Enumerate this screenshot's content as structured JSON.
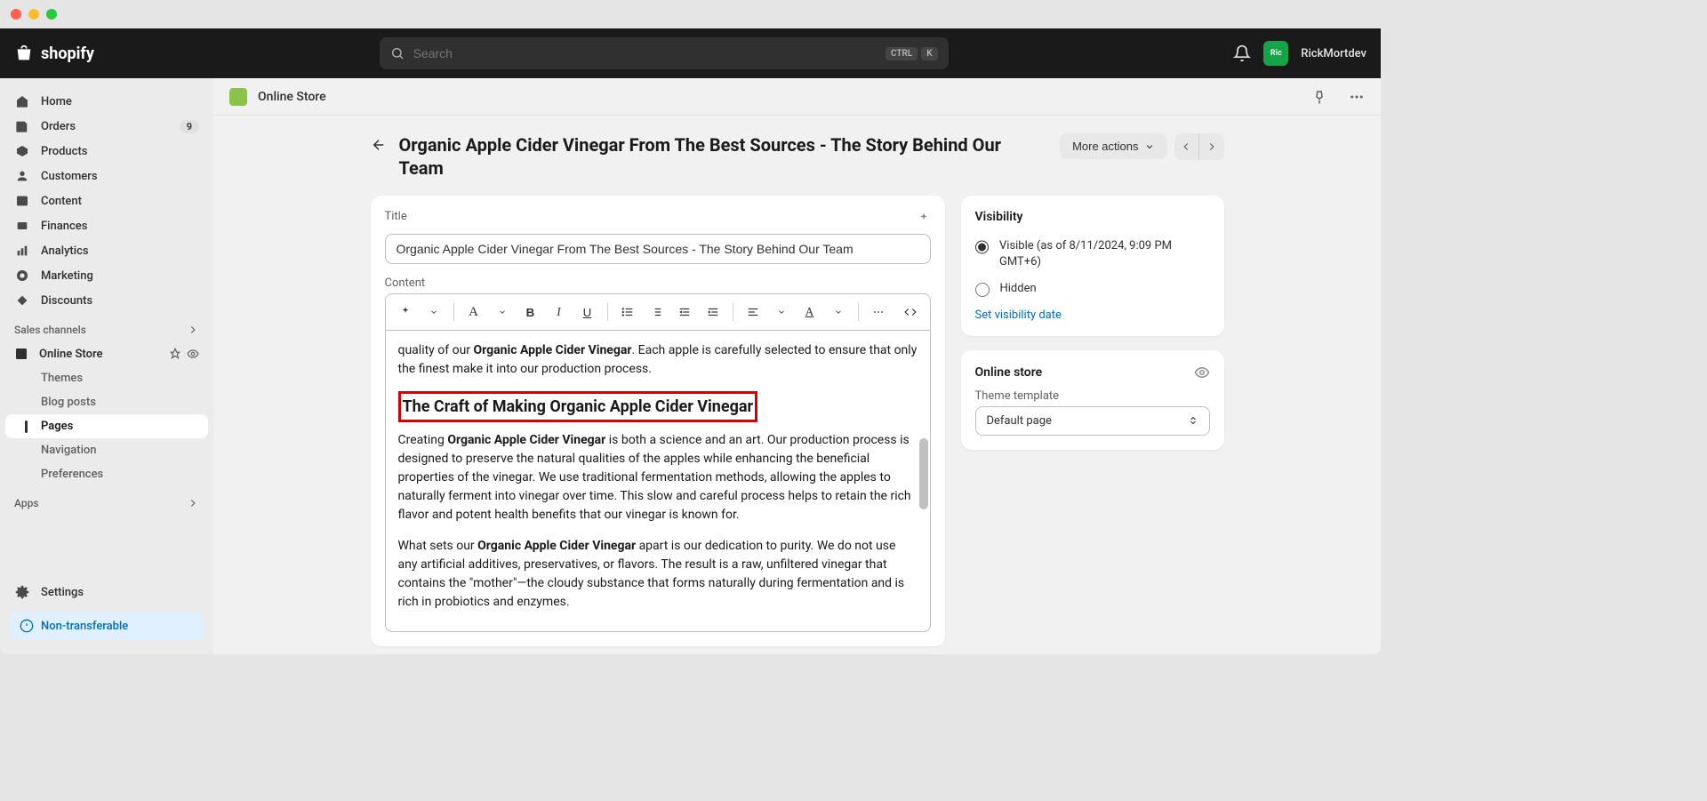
{
  "header": {
    "brand": "shopify",
    "search_placeholder": "Search",
    "kbd_ctrl": "CTRL",
    "kbd_k": "K",
    "avatar_short": "Ric",
    "username": "RickMortdev"
  },
  "sidebar": {
    "home": "Home",
    "orders": {
      "label": "Orders",
      "badge": "9"
    },
    "products": "Products",
    "customers": "Customers",
    "content": "Content",
    "finances": "Finances",
    "analytics": "Analytics",
    "marketing": "Marketing",
    "discounts": "Discounts",
    "sales_channels": "Sales channels",
    "online_store": "Online Store",
    "themes": "Themes",
    "blog_posts": "Blog posts",
    "pages": "Pages",
    "navigation": "Navigation",
    "preferences": "Preferences",
    "apps": "Apps",
    "settings": "Settings",
    "non_transferable": "Non-transferable"
  },
  "main_header": {
    "title": "Online Store"
  },
  "page": {
    "title": "Organic Apple Cider Vinegar From The Best Sources - The Story Behind Our Team",
    "more_actions": "More actions"
  },
  "editor": {
    "title_label": "Title",
    "title_value": "Organic Apple Cider Vinegar From The Best Sources - The Story Behind Our Team",
    "content_label": "Content",
    "para1_pre": "quality of our ",
    "para1_bold": "Organic Apple Cider Vinegar",
    "para1_post": ". Each apple is carefully selected to ensure that only the finest make it into our production process.",
    "heading1": "The Craft of Making Organic Apple Cider Vinegar",
    "para2_pre": "Creating ",
    "para2_bold": "Organic Apple Cider Vinegar",
    "para2_post": " is both a science and an art. Our production process is designed to preserve the natural qualities of the apples while enhancing the beneficial properties of the vinegar. We use traditional fermentation methods, allowing the apples to naturally ferment into vinegar over time. This slow and careful process helps to retain the rich flavor and potent health benefits that our vinegar is known for.",
    "para3_pre": "What sets our ",
    "para3_bold": "Organic Apple Cider Vinegar",
    "para3_post": " apart is our dedication to purity. We do not use any artificial additives, preservatives, or flavors. The result is a raw, unfiltered vinegar that contains the \"mother\"—the cloudy substance that forms naturally during fermentation and is rich in probiotics and enzymes."
  },
  "visibility": {
    "header": "Visibility",
    "visible_label": "Visible (as of 8/11/2024, 9:09 PM GMT+6)",
    "hidden_label": "Hidden",
    "set_date": "Set visibility date"
  },
  "online_store_card": {
    "header": "Online store",
    "template_label": "Theme template",
    "template_value": "Default page"
  }
}
